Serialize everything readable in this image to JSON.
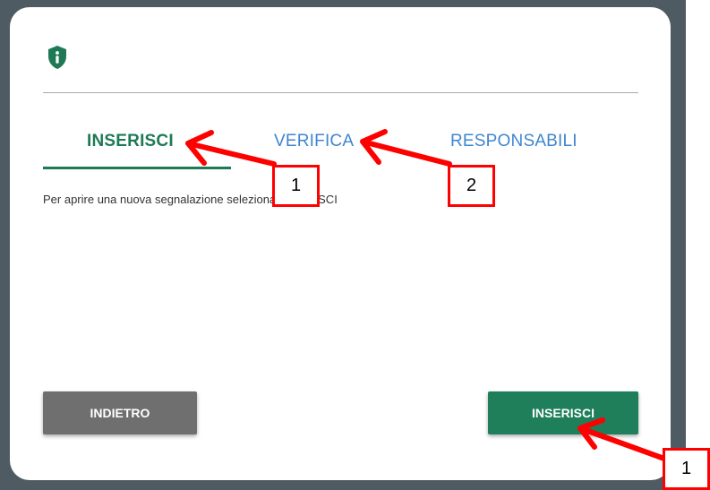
{
  "dialog": {
    "header_icon": "shield-info-icon",
    "tabs": [
      {
        "label": "INSERISCI",
        "active": true
      },
      {
        "label": "VERIFICA",
        "active": false
      },
      {
        "label": "RESPONSABILI",
        "active": false
      }
    ],
    "info_text": "Per aprire una nuova segnalazione seleziona INSERISCI",
    "buttons": {
      "back_label": "INDIETRO",
      "insert_label": "INSERISCI"
    }
  },
  "annotations": {
    "callouts": [
      "1",
      "2",
      "1"
    ],
    "color": "#ff0000"
  },
  "colors": {
    "accent_green": "#1e7a55",
    "tab_blue": "#3f86cf",
    "back_button": "#6f6f6f",
    "backdrop": "#4f5b62"
  }
}
